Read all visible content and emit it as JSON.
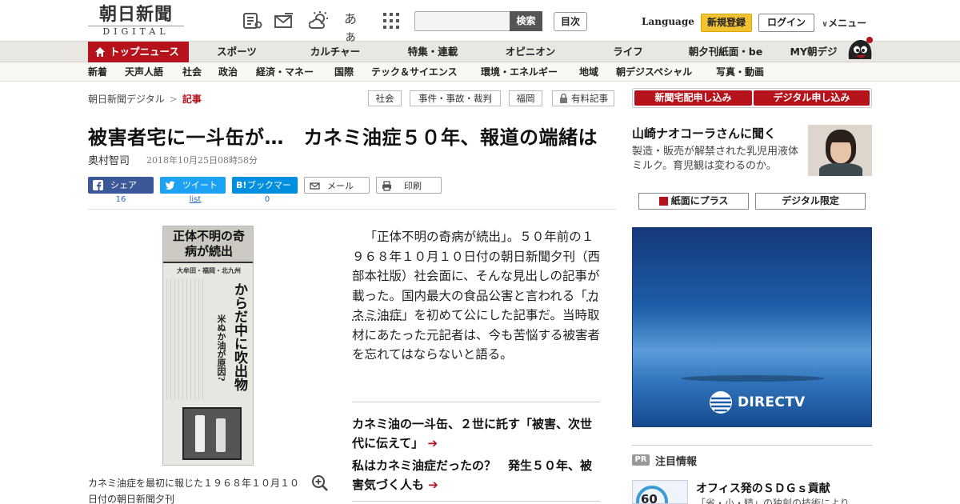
{
  "header": {
    "logo_main": "朝日新聞",
    "logo_sub": "DIGITAL",
    "search_placeholder": "",
    "search_button": "検索",
    "toc_button": "目次",
    "language": "Language",
    "register": "新規登録",
    "login": "ログイン",
    "menu": "メニュー",
    "font_size_icon_label": "あぁ",
    "icons": [
      "newspaper-icon",
      "mail-icon",
      "weather-icon",
      "font-size-icon",
      "grid-icon"
    ]
  },
  "nav_primary": [
    "トップニュース",
    "スポーツ",
    "カルチャー",
    "特集・連載",
    "オピニオン",
    "ライフ",
    "朝夕刊紙面・be",
    "MY朝デジ"
  ],
  "nav_secondary": [
    "新着",
    "天声人語",
    "社会",
    "政治",
    "経済・マネー",
    "国際",
    "テック＆サイエンス",
    "環境・エネルギー",
    "地域",
    "朝デジスペシャル",
    "写真・動画"
  ],
  "breadcrumb": {
    "home": "朝日新聞デジタル",
    "sep": ">",
    "current": "記事"
  },
  "tags": [
    "社会",
    "事件・事故・裁判",
    "福岡",
    "有料記事"
  ],
  "article": {
    "title": "被害者宅に一斗缶が…　カネミ油症５０年、報道の端緒は",
    "author": "奥村智司",
    "date": "2018年10月25日08時58分",
    "lead_before": "「正体不明の奇病が続出」。５０年前の１９６８年１０月１０日付の朝日新聞夕刊（西部本社版）社会面に、そんな見出しの記事が載った。国内最大の食品公害と言われる「",
    "lead_term": "カネミ油症",
    "lead_after": "」を初めて公にした記事だ。当時取材にあたった元記者は、今も苦悩する被害者を忘れてはならないと語る。",
    "caption": "カネミ油症を最初に報じた１９６８年１０月１０日付の朝日新聞夕刊",
    "clip_headline": "正体不明の奇病が続出",
    "clip_sub": "大牟田・福岡・北九州",
    "clip_main": "からだ中に吹出物",
    "clip_cause": "米ぬか油が原因?",
    "related": [
      {
        "text": "カネミ油の一斗缶、２世に託す「被害、次世代に伝えて」",
        "arrow": "➔"
      },
      {
        "text": "私はカネミ油症だったの？　発生５０年、被害気づく人も",
        "arrow": "➔"
      }
    ]
  },
  "share": [
    {
      "label": "シェア",
      "count": "16",
      "color": "#3b5998"
    },
    {
      "label": "ツイート",
      "count": "list",
      "color": "#1da1f2"
    },
    {
      "label": "ブックマーク",
      "count": "0",
      "color": "#008fde"
    },
    {
      "label": "メール",
      "count": ""
    },
    {
      "label": "印刷",
      "count": ""
    }
  ],
  "sidebar": {
    "subscribe_paper": "新聞宅配申し込み",
    "subscribe_digital": "デジタル申し込み",
    "interview_heading": "山崎ナオコーラさんに聞く",
    "interview_body": "製造・販売が解禁された乳児用液体ミルク。育児観は変わるのか。",
    "paper_plus": "紙面にプラス",
    "digital_only": "デジタル限定",
    "ad_brand": "DIRECTV",
    "pr_badge": "PR",
    "pr_heading": "注目情報",
    "pr_title": "オフィス発のＳＤＧｓ貢献",
    "pr_desc": "「省・小・精」の独創の技術により",
    "pr_thumb_number": "60"
  },
  "colors": {
    "accent": "#b5121b",
    "register": "#f1c232",
    "nav_bg": "#e9e7e2"
  }
}
